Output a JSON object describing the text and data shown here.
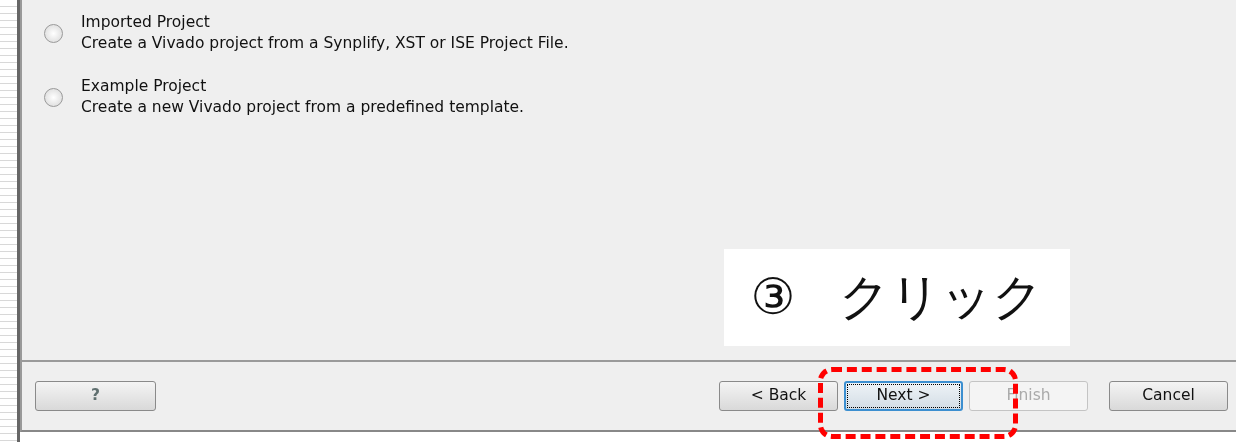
{
  "options": [
    {
      "title": "Imported Project",
      "description": "Create a Vivado project from a Synplify, XST or ISE Project File.",
      "selected": false
    },
    {
      "title": "Example Project",
      "description": "Create a new Vivado project from a predefined template.",
      "selected": false
    }
  ],
  "annotation": {
    "number": "③",
    "text": "クリック"
  },
  "buttons": [
    {
      "label": "?",
      "kind": "help",
      "disabled": false,
      "default": false
    },
    {
      "label": "< Back",
      "kind": "nav",
      "disabled": false,
      "default": false
    },
    {
      "label": "Next >",
      "kind": "nav",
      "disabled": false,
      "default": true
    },
    {
      "label": "Finish",
      "kind": "nav",
      "disabled": true,
      "default": false
    },
    {
      "label": "Cancel",
      "kind": "cancel",
      "disabled": false,
      "default": false
    }
  ]
}
